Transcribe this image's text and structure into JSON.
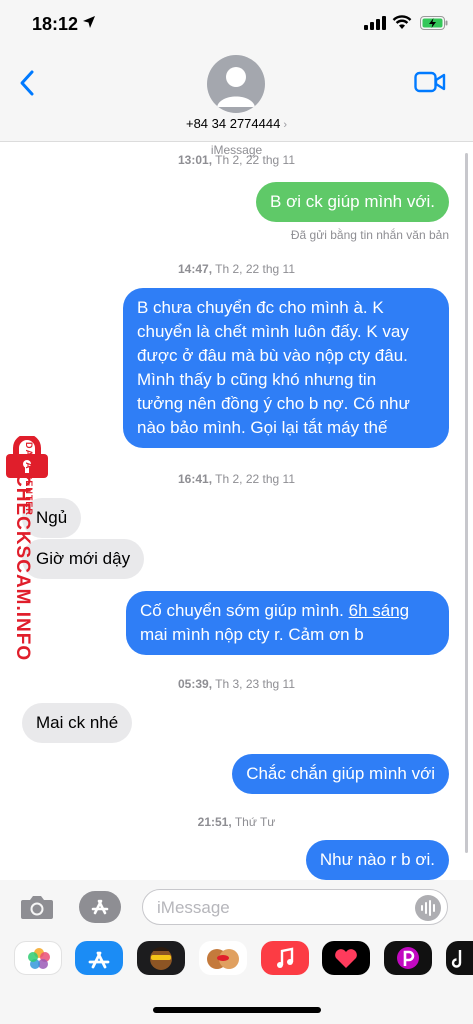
{
  "status_bar": {
    "time": "18:12"
  },
  "header": {
    "contact": "+84 34 2774444",
    "contact_chevron": "›"
  },
  "conversation": {
    "service_label": "iMessage",
    "messages": [
      {
        "type": "stamp",
        "time": "13:01,",
        "date": "Th 2, 22 thg 11"
      },
      {
        "type": "sms",
        "text": "B ơi ck giúp mình với."
      },
      {
        "type": "note",
        "text": "Đã gửi bằng tin nhắn văn bản"
      },
      {
        "type": "stamp",
        "time": "14:47,",
        "date": "Th 2, 22 thg 11"
      },
      {
        "type": "out",
        "lines": [
          "B chưa chuyển đc cho mình à. K",
          "chuyển là chết mình luôn đấy. K vay",
          "được ở đâu mà bù vào nộp cty đâu.",
          "Mình thấy b cũng khó nhưng tin",
          "tưởng nên đồng ý cho b nợ. Có như",
          "nào bảo mình. Gọi lại tắt máy thế"
        ]
      },
      {
        "type": "stamp",
        "time": "16:41,",
        "date": "Th 2, 22 thg 11"
      },
      {
        "type": "in",
        "text": "Ngủ"
      },
      {
        "type": "in",
        "text": "Giờ mới dậy"
      },
      {
        "type": "out",
        "line1_before": "Cố chuyển sớm giúp mình. ",
        "line1_link": "6h sáng",
        "line2": "mai mình nộp cty r. Cảm ơn b"
      },
      {
        "type": "stamp",
        "time": "05:39,",
        "date": "Th 3, 23 thg 11"
      },
      {
        "type": "in",
        "text": "Mai ck nhé"
      },
      {
        "type": "out",
        "text": "Chắc chắn giúp mình với"
      },
      {
        "type": "stamp",
        "time": "21:51,",
        "date": "Thứ Tư"
      },
      {
        "type": "out",
        "text": "Như nào r b ơi."
      }
    ]
  },
  "input": {
    "placeholder": "iMessage"
  },
  "watermark": {
    "name": "CHECKSCAM.INFO",
    "subtitle": "DATA CENTER"
  },
  "app_drawer": {
    "icons": [
      "photos-icon",
      "app-store-icon",
      "memoji-icon",
      "memoji-stickers-icon",
      "music-icon",
      "digital-touch-icon",
      "picsart-icon",
      "tiktok-icon"
    ]
  },
  "colors": {
    "outgoing": "#2f7ef6",
    "sms": "#5fc968",
    "incoming": "#e9e9eb",
    "accent": "#007aff",
    "watermark": "#e01e2b"
  }
}
